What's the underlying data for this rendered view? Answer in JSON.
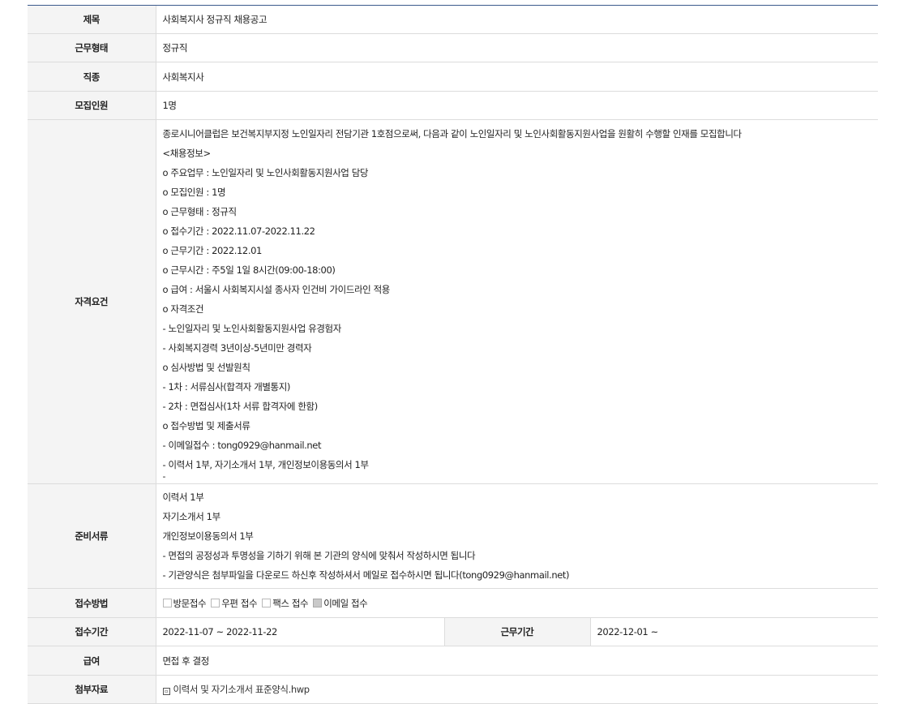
{
  "rows": {
    "title": {
      "label": "제목",
      "value": "사회복지사 정규직 채용공고"
    },
    "work_type": {
      "label": "근무형태",
      "value": "정규직"
    },
    "job": {
      "label": "직종",
      "value": "사회복지사"
    },
    "headcount": {
      "label": "모집인원",
      "value": "1명"
    },
    "qualifications": {
      "label": "자격요건",
      "lines": [
        "종로시니어클럽은 보건복지부지정 노인일자리 전담기관 1호점으로써, 다음과 같이 노인일자리 및 노인사회활동지원사업을 원활히 수행할 인재를 모집합니다",
        "<채용정보>",
        "o 주요업무 : 노인일자리 및 노인사회활동지원사업 담당",
        "o 모집인원 : 1명",
        "o 근무형태 : 정규직",
        "o 접수기간 : 2022.11.07-2022.11.22",
        "o 근무기간 : 2022.12.01",
        "o 근무시간 : 주5일 1일 8시간(09:00-18:00)",
        "o 급여 : 서울시 사회복지시설 종사자 인건비 가이드라인 적용",
        "o 자격조건",
        " - 노인일자리 및 노인사회활동지원사업 유경험자",
        " - 사회복지경력 3년이상-5년미만 경력자",
        "o 심사방법 및 선발원칙",
        " - 1차 : 서류심사(합격자 개별통지)",
        " - 2차 : 면접심사(1차 서류 합격자에 한함)",
        "o 접수방법 및 제출서류",
        " - 이메일접수 : tong0929@hanmail.net",
        " - 이력서 1부, 자기소개서 1부, 개인정보이용동의서 1부"
      ],
      "trailing": "-"
    },
    "documents": {
      "label": "준비서류",
      "lines": [
        "이력서 1부",
        "자기소개서 1부",
        "개인정보이용동의서 1부",
        " - 면접의 공정성과 투명성을 기하기 위해 본 기관의 양식에 맞춰서 작성하시면 됩니다",
        " - 기관양식은 첨부파일을 다운로드 하신후 작성하셔서 메일로 접수하시면 됩니다(tong0929@hanmail.net)"
      ]
    },
    "method": {
      "label": "접수방법",
      "options": [
        {
          "label": "방문접수",
          "checked": false
        },
        {
          "label": "우편 접수",
          "checked": false
        },
        {
          "label": "팩스 접수",
          "checked": false
        },
        {
          "label": "이메일 접수",
          "checked": true
        }
      ]
    },
    "period": {
      "label": "접수기간",
      "value": "2022-11-07 ~ 2022-11-22",
      "work_label": "근무기간",
      "work_value": "2022-12-01 ~"
    },
    "salary": {
      "label": "급여",
      "value": "면접 후 결정"
    },
    "attachment": {
      "label": "첨부자료",
      "file": "이력서 및 자기소개서 표준양식.hwp"
    }
  }
}
